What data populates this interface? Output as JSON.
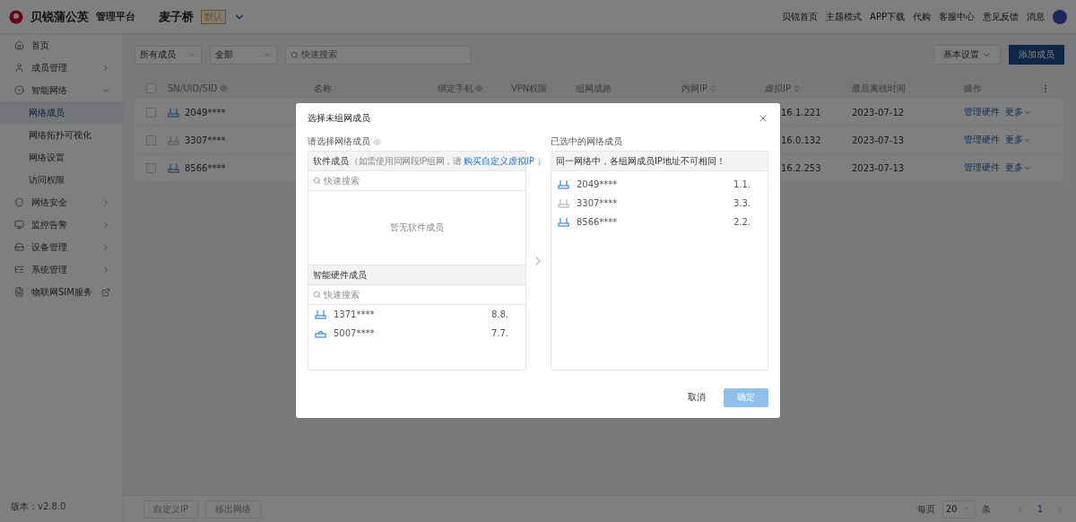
{
  "header": {
    "brand": "贝锐蒲公英",
    "platform": "管理平台",
    "network": "麦子桥",
    "network_badge": "默认",
    "nav": [
      "贝锐首页",
      "主题模式",
      "APP下载",
      "代购",
      "客服中心",
      "意见反馈",
      "消息"
    ]
  },
  "sidebar": {
    "items": [
      {
        "label": "首页",
        "kind": "page"
      },
      {
        "label": "成员管理",
        "kind": "group",
        "expanded": false
      },
      {
        "label": "智能网络",
        "kind": "group",
        "expanded": true,
        "children": [
          {
            "label": "网络成员",
            "selected": true
          },
          {
            "label": "网络拓扑可视化",
            "selected": false
          },
          {
            "label": "网络设置",
            "selected": false
          },
          {
            "label": "访问权限",
            "selected": false
          }
        ]
      },
      {
        "label": "网络安全",
        "kind": "group",
        "expanded": false
      },
      {
        "label": "监控告警",
        "kind": "group",
        "expanded": false
      },
      {
        "label": "设备管理",
        "kind": "group",
        "expanded": false
      },
      {
        "label": "系统管理",
        "kind": "group",
        "expanded": false
      },
      {
        "label": "物联网SIM服务",
        "kind": "external"
      }
    ],
    "version": "版本：v2.8.0"
  },
  "toolbar": {
    "filters": [
      "所有成员",
      "全部"
    ],
    "search": {
      "placeholder": "快速搜索"
    },
    "settings": "基本设置",
    "add": "添加成员"
  },
  "table": {
    "select_all": {
      "checked": false
    },
    "columns": [
      {
        "label": "SN/UID/SID"
      },
      {
        "label": "名称"
      },
      {
        "label": "绑定手机"
      },
      {
        "label": "VPN权限"
      },
      {
        "label": "组网成路"
      },
      {
        "label": "内网IP"
      },
      {
        "label": "虚拟IP"
      },
      {
        "label": "最后离线时间"
      },
      {
        "label": "操作"
      }
    ],
    "rows": [
      {
        "checked": false,
        "online": true,
        "sn": "2049****",
        "virtual_ip": "16.1.221",
        "last_offline": "2023-07-12",
        "actions": [
          "管理硬件",
          "更多"
        ]
      },
      {
        "checked": false,
        "online": false,
        "sn": "3307****",
        "virtual_ip": "16.0.132",
        "last_offline": "2023-07-13",
        "actions": [
          "管理硬件",
          "更多"
        ]
      },
      {
        "checked": false,
        "online": true,
        "sn": "8566****",
        "virtual_ip": "16.2.253",
        "last_offline": "2023-07-13",
        "actions": [
          "管理硬件",
          "更多"
        ]
      }
    ]
  },
  "footer": {
    "buttons": [
      {
        "label": "自定义IP",
        "disabled": true
      },
      {
        "label": "移出网络",
        "disabled": true
      }
    ],
    "pagination": {
      "per_page": "每页",
      "page_size": "20",
      "unit": "条",
      "pages": [
        {
          "label": "1",
          "selected": true
        }
      ]
    }
  },
  "dialog": {
    "title": "选择未组网成员",
    "left": {
      "label": "请选择网络成员",
      "software": {
        "title": "软件成员",
        "hint_before": "（如需使用同网段IP组网，请",
        "link": "购买自定义虚拟IP",
        "hint_after": "）",
        "search": {
          "placeholder": "快速搜索"
        },
        "empty": "暂无软件成员"
      },
      "hardware": {
        "title": "智能硬件成员",
        "search": {
          "placeholder": "快速搜索"
        },
        "items": [
          {
            "kind": "router",
            "online": true,
            "sn": "1371****",
            "ip": "8.8."
          },
          {
            "kind": "box",
            "online": true,
            "sn": "5007****",
            "ip": "7.7."
          }
        ]
      }
    },
    "right": {
      "label": "已选中的网络成员",
      "notice": "同一网络中，各组网成员IP地址不可相同！",
      "items": [
        {
          "kind": "router",
          "online": true,
          "sn": "2049****",
          "ip": "1.1."
        },
        {
          "kind": "router",
          "online": false,
          "sn": "3307****",
          "ip": "3.3."
        },
        {
          "kind": "router",
          "online": true,
          "sn": "8566****",
          "ip": "2.2."
        }
      ]
    },
    "cancel": "取消",
    "confirm": {
      "label": "确定",
      "disabled": true
    }
  }
}
